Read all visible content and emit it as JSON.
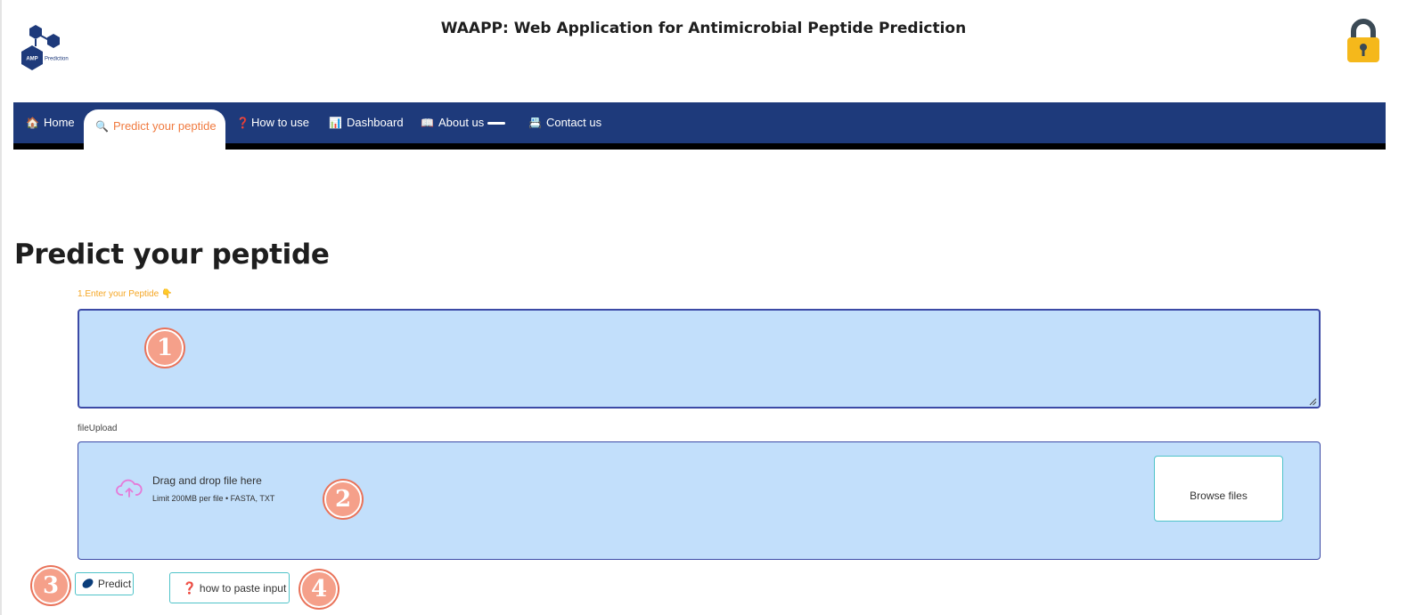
{
  "header": {
    "title": "WAAPP: Web Application for Antimicrobial Peptide Prediction",
    "logo": {
      "badge_text": "AMP",
      "text": "Prediction",
      "icon": "hexagon-molecule-icon"
    },
    "lock_icon": "lock-icon"
  },
  "nav": {
    "items": [
      {
        "label": "Home",
        "icon": "house-icon",
        "glyph": "🏠",
        "active": false
      },
      {
        "label": "Predict your peptide",
        "icon": "magnifier-icon",
        "glyph": "🔍",
        "active": true
      },
      {
        "label": "How to use",
        "icon": "question-icon",
        "glyph": "❓",
        "active": false
      },
      {
        "label": "Dashboard",
        "icon": "bar-chart-icon",
        "glyph": "📊",
        "active": false
      },
      {
        "label": "About us",
        "icon": "book-icon",
        "glyph": "📖",
        "active": false
      },
      {
        "label": "Contact us",
        "icon": "card-icon",
        "glyph": "📇",
        "active": false
      }
    ]
  },
  "main": {
    "page_title": "Predict your peptide",
    "peptide_input": {
      "label": "1.Enter your Peptide",
      "label_glyph": "👇",
      "value": "",
      "placeholder": ""
    },
    "file_upload": {
      "label": "fileUpload",
      "drop_text": "Drag and drop file here",
      "limit_text": "Limit 200MB per file • FASTA, TXT",
      "browse_label": "Browse files"
    },
    "predict_button": {
      "label": "Predict",
      "icon": "pill-icon"
    },
    "howto_button": {
      "label": "how to paste input",
      "glyph": "❓"
    }
  },
  "annotations": {
    "badges": [
      "1",
      "2",
      "3",
      "4"
    ],
    "color": "#e9735a"
  },
  "colors": {
    "nav_bg": "#1e3a7b",
    "active_tab_text": "#f07a3f",
    "input_bg": "#c2dffb",
    "input_border": "#3c4aa6",
    "button_border": "#4fc3c9",
    "label_orange": "#f5a623"
  }
}
